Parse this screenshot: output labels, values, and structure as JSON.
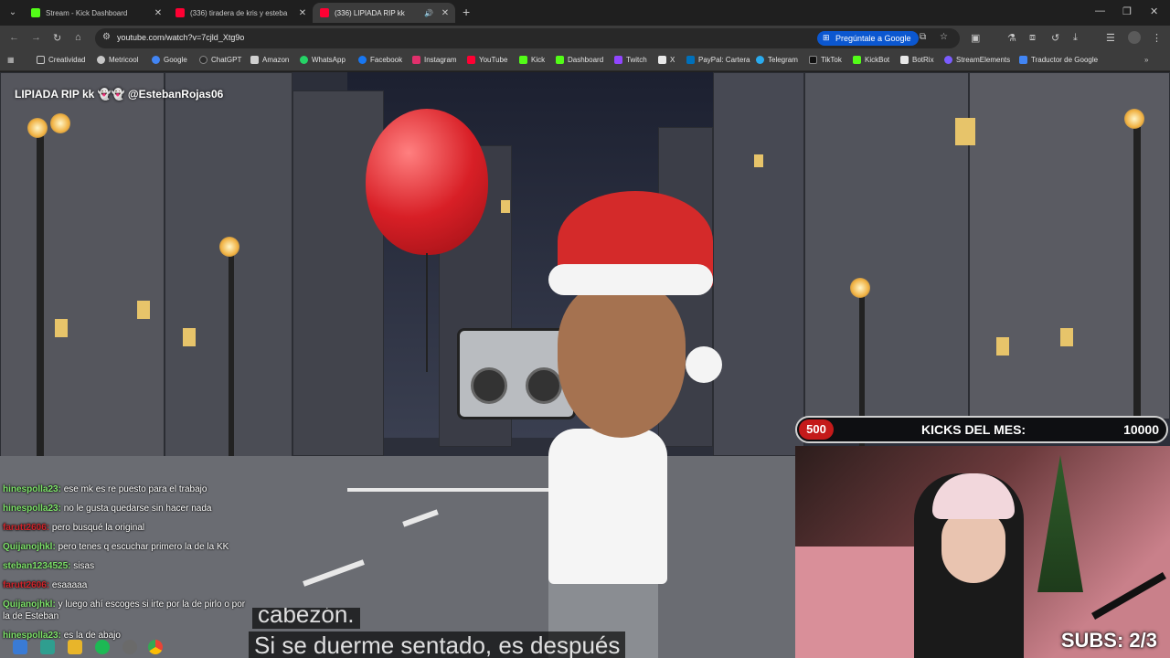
{
  "browser": {
    "tabs": [
      {
        "title": "Stream - Kick Dashboard",
        "favicon": "kick-icon",
        "color": "#53fc18",
        "active": false
      },
      {
        "title": "(336) tiradera de kris y esteba",
        "favicon": "youtube-icon",
        "color": "#ff0033",
        "active": false
      },
      {
        "title": "(336) LIPIADA RIP kk",
        "favicon": "youtube-icon",
        "color": "#ff0033",
        "active": true
      }
    ],
    "url": "youtube.com/watch?v=7cjld_Xtg9o",
    "ask_google": "Pregúntale a Google",
    "bookmarks": [
      {
        "label": "Creatividad",
        "icon": "folder-icon",
        "color": "#c7c7c7"
      },
      {
        "label": "Metricool",
        "icon": "metricool-icon",
        "color": "#c7c7c7"
      },
      {
        "label": "Google",
        "icon": "google-icon",
        "color": "#4285f4"
      },
      {
        "label": "ChatGPT",
        "icon": "chatgpt-icon",
        "color": "#2a2a2a"
      },
      {
        "label": "Amazon",
        "icon": "amazon-icon",
        "color": "#d0d0d0"
      },
      {
        "label": "WhatsApp",
        "icon": "whatsapp-icon",
        "color": "#25d366"
      },
      {
        "label": "Facebook",
        "icon": "facebook-icon",
        "color": "#1877f2"
      },
      {
        "label": "Instagram",
        "icon": "instagram-icon",
        "color": "#e1306c"
      },
      {
        "label": "YouTube",
        "icon": "youtube-icon",
        "color": "#ff0033"
      },
      {
        "label": "Kick",
        "icon": "kick-icon",
        "color": "#53fc18"
      },
      {
        "label": "Dashboard",
        "icon": "kick-icon",
        "color": "#53fc18"
      },
      {
        "label": "Twitch",
        "icon": "twitch-icon",
        "color": "#9146ff"
      },
      {
        "label": "X",
        "icon": "x-icon",
        "color": "#e8e8e8"
      },
      {
        "label": "PayPal: Cartera",
        "icon": "paypal-icon",
        "color": "#0070ba"
      },
      {
        "label": "Telegram",
        "icon": "telegram-icon",
        "color": "#2aabee"
      },
      {
        "label": "TikTok",
        "icon": "tiktok-icon",
        "color": "#111111"
      },
      {
        "label": "KickBot",
        "icon": "kick-icon",
        "color": "#53fc18"
      },
      {
        "label": "BotRix",
        "icon": "botrix-icon",
        "color": "#e8e8e8"
      },
      {
        "label": "StreamElements",
        "icon": "streamelements-icon",
        "color": "#7b5cff"
      },
      {
        "label": "Traductor de Google",
        "icon": "translate-icon",
        "color": "#4285f4"
      }
    ]
  },
  "stream": {
    "title": "LIPIADA RIP kk 👻👻 @EstebanRojas06",
    "kicks_current": "500",
    "kicks_label": "KICKS DEL MES:",
    "kicks_goal": "10000",
    "subs": "SUBS: 2/3",
    "caption_line1": "cabezón.",
    "caption_line2": "Si se duerme sentado, es después",
    "chat": [
      {
        "user": "hinespolla23:",
        "user_color": "#7ee36a",
        "msg": "ese mk es re puesto para el trabajo"
      },
      {
        "user": "hinespolla23:",
        "user_color": "#7ee36a",
        "msg": "no le gusta quedarse sin hacer nada"
      },
      {
        "user": "farutt2606:",
        "user_color": "#d0242b",
        "msg": "pero busqué la original"
      },
      {
        "user": "Quijanojhkl:",
        "user_color": "#7ee36a",
        "msg": "pero tenes q escuchar primero la de la KK"
      },
      {
        "user": "steban1234525:",
        "user_color": "#7ee36a",
        "msg": "sisas"
      },
      {
        "user": "farutt2606:",
        "user_color": "#d0242b",
        "msg": "esaaaaa"
      },
      {
        "user": "Quijanojhkl:",
        "user_color": "#7ee36a",
        "msg": "y luego ahí escoges si irte por la de pirlo o por la de Esteban"
      },
      {
        "user": "hinespolla23:",
        "user_color": "#7ee36a",
        "msg": "es la de abajo"
      }
    ]
  }
}
